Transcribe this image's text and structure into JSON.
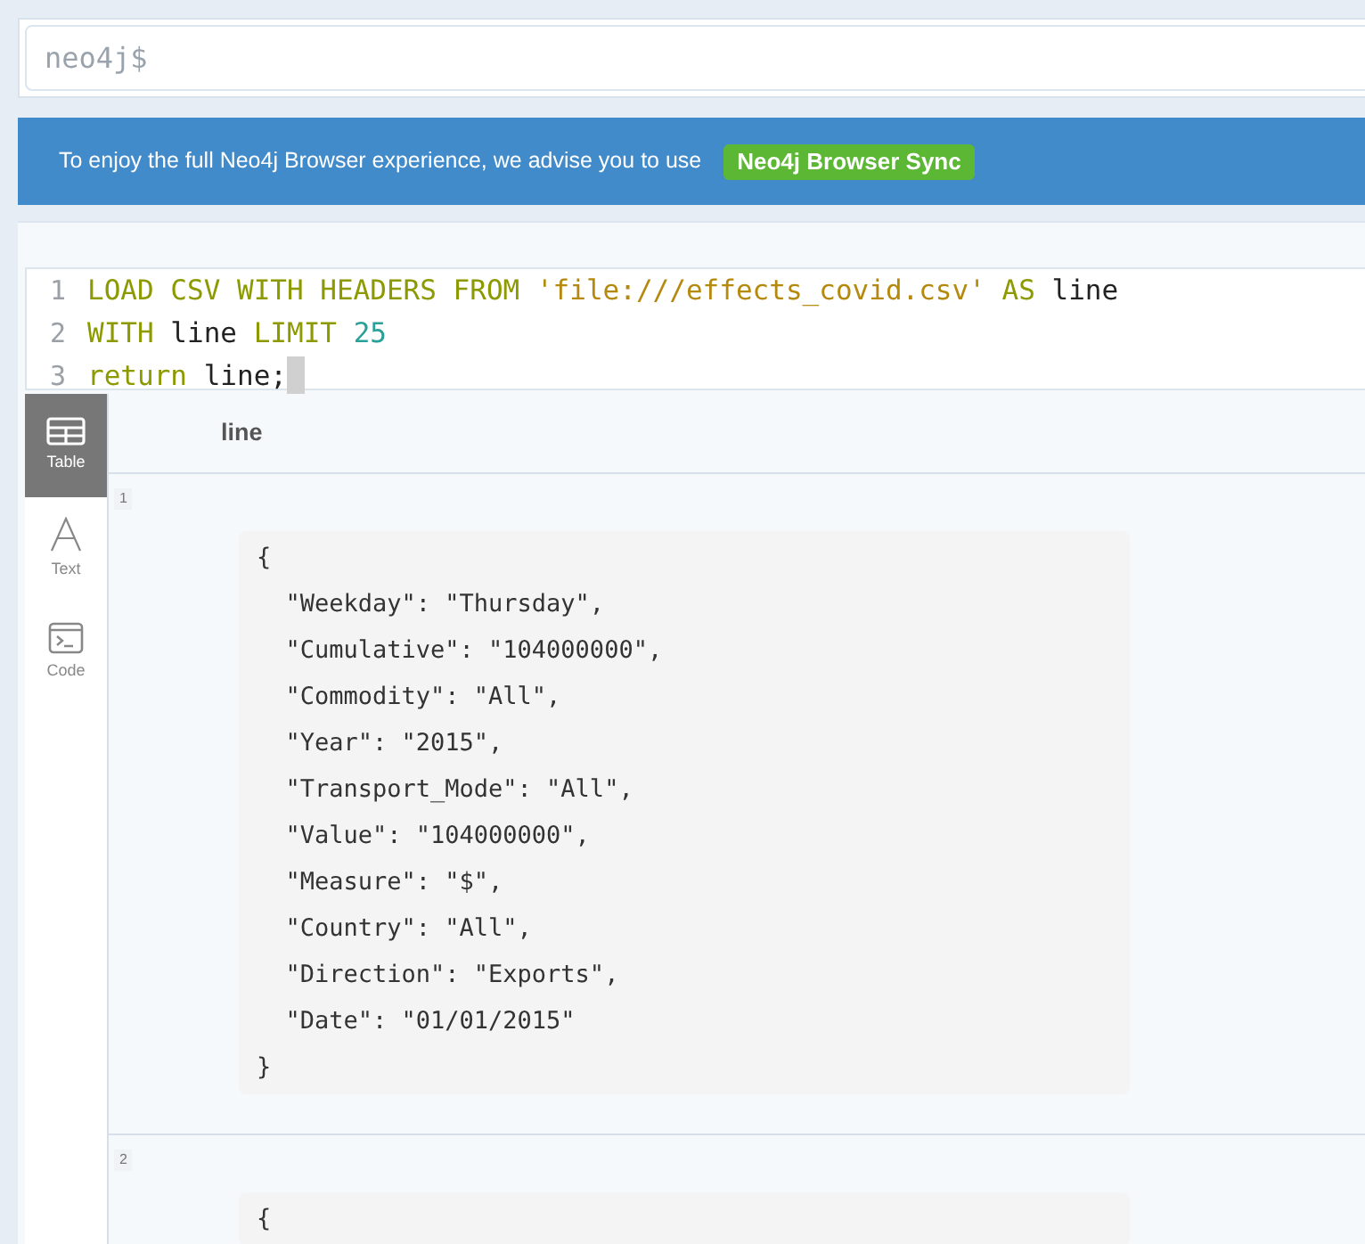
{
  "prompt": {
    "placeholder": "neo4j$"
  },
  "banner": {
    "text": "To enjoy the full Neo4j Browser experience, we advise you to use",
    "button": "Neo4j Browser Sync"
  },
  "query": {
    "lines": [
      {
        "number": "1",
        "tokens": [
          {
            "kind": "keyword",
            "text": "LOAD CSV WITH HEADERS FROM"
          },
          {
            "kind": "string",
            "text": "'file:///effects_covid.csv'"
          },
          {
            "kind": "keyword",
            "text": "AS"
          },
          {
            "kind": "plain",
            "text": "line"
          }
        ]
      },
      {
        "number": "2",
        "tokens": [
          {
            "kind": "keyword",
            "text": "WITH"
          },
          {
            "kind": "plain",
            "text": "line"
          },
          {
            "kind": "keyword",
            "text": "LIMIT"
          },
          {
            "kind": "number",
            "text": "25"
          }
        ]
      },
      {
        "number": "3",
        "tokens": [
          {
            "kind": "keyword",
            "text": "return"
          },
          {
            "kind": "plain",
            "text": "line;"
          }
        ]
      }
    ]
  },
  "view_tabs": [
    {
      "label": "Table",
      "kind": "table",
      "selected": true
    },
    {
      "label": "Text",
      "kind": "text",
      "selected": false
    },
    {
      "label": "Code",
      "kind": "code",
      "selected": false
    }
  ],
  "table": {
    "columns": [
      "line"
    ],
    "rows": [
      {
        "number": "1",
        "lines": [
          "{",
          "  \"Weekday\": \"Thursday\",",
          "  \"Cumulative\": \"104000000\",",
          "  \"Commodity\": \"All\",",
          "  \"Year\": \"2015\",",
          "  \"Transport_Mode\": \"All\",",
          "  \"Value\": \"104000000\",",
          "  \"Measure\": \"$\",",
          "  \"Country\": \"All\",",
          "  \"Direction\": \"Exports\",",
          "  \"Date\": \"01/01/2015\"",
          "}"
        ]
      },
      {
        "number": "2",
        "lines": [
          "{"
        ]
      }
    ]
  }
}
